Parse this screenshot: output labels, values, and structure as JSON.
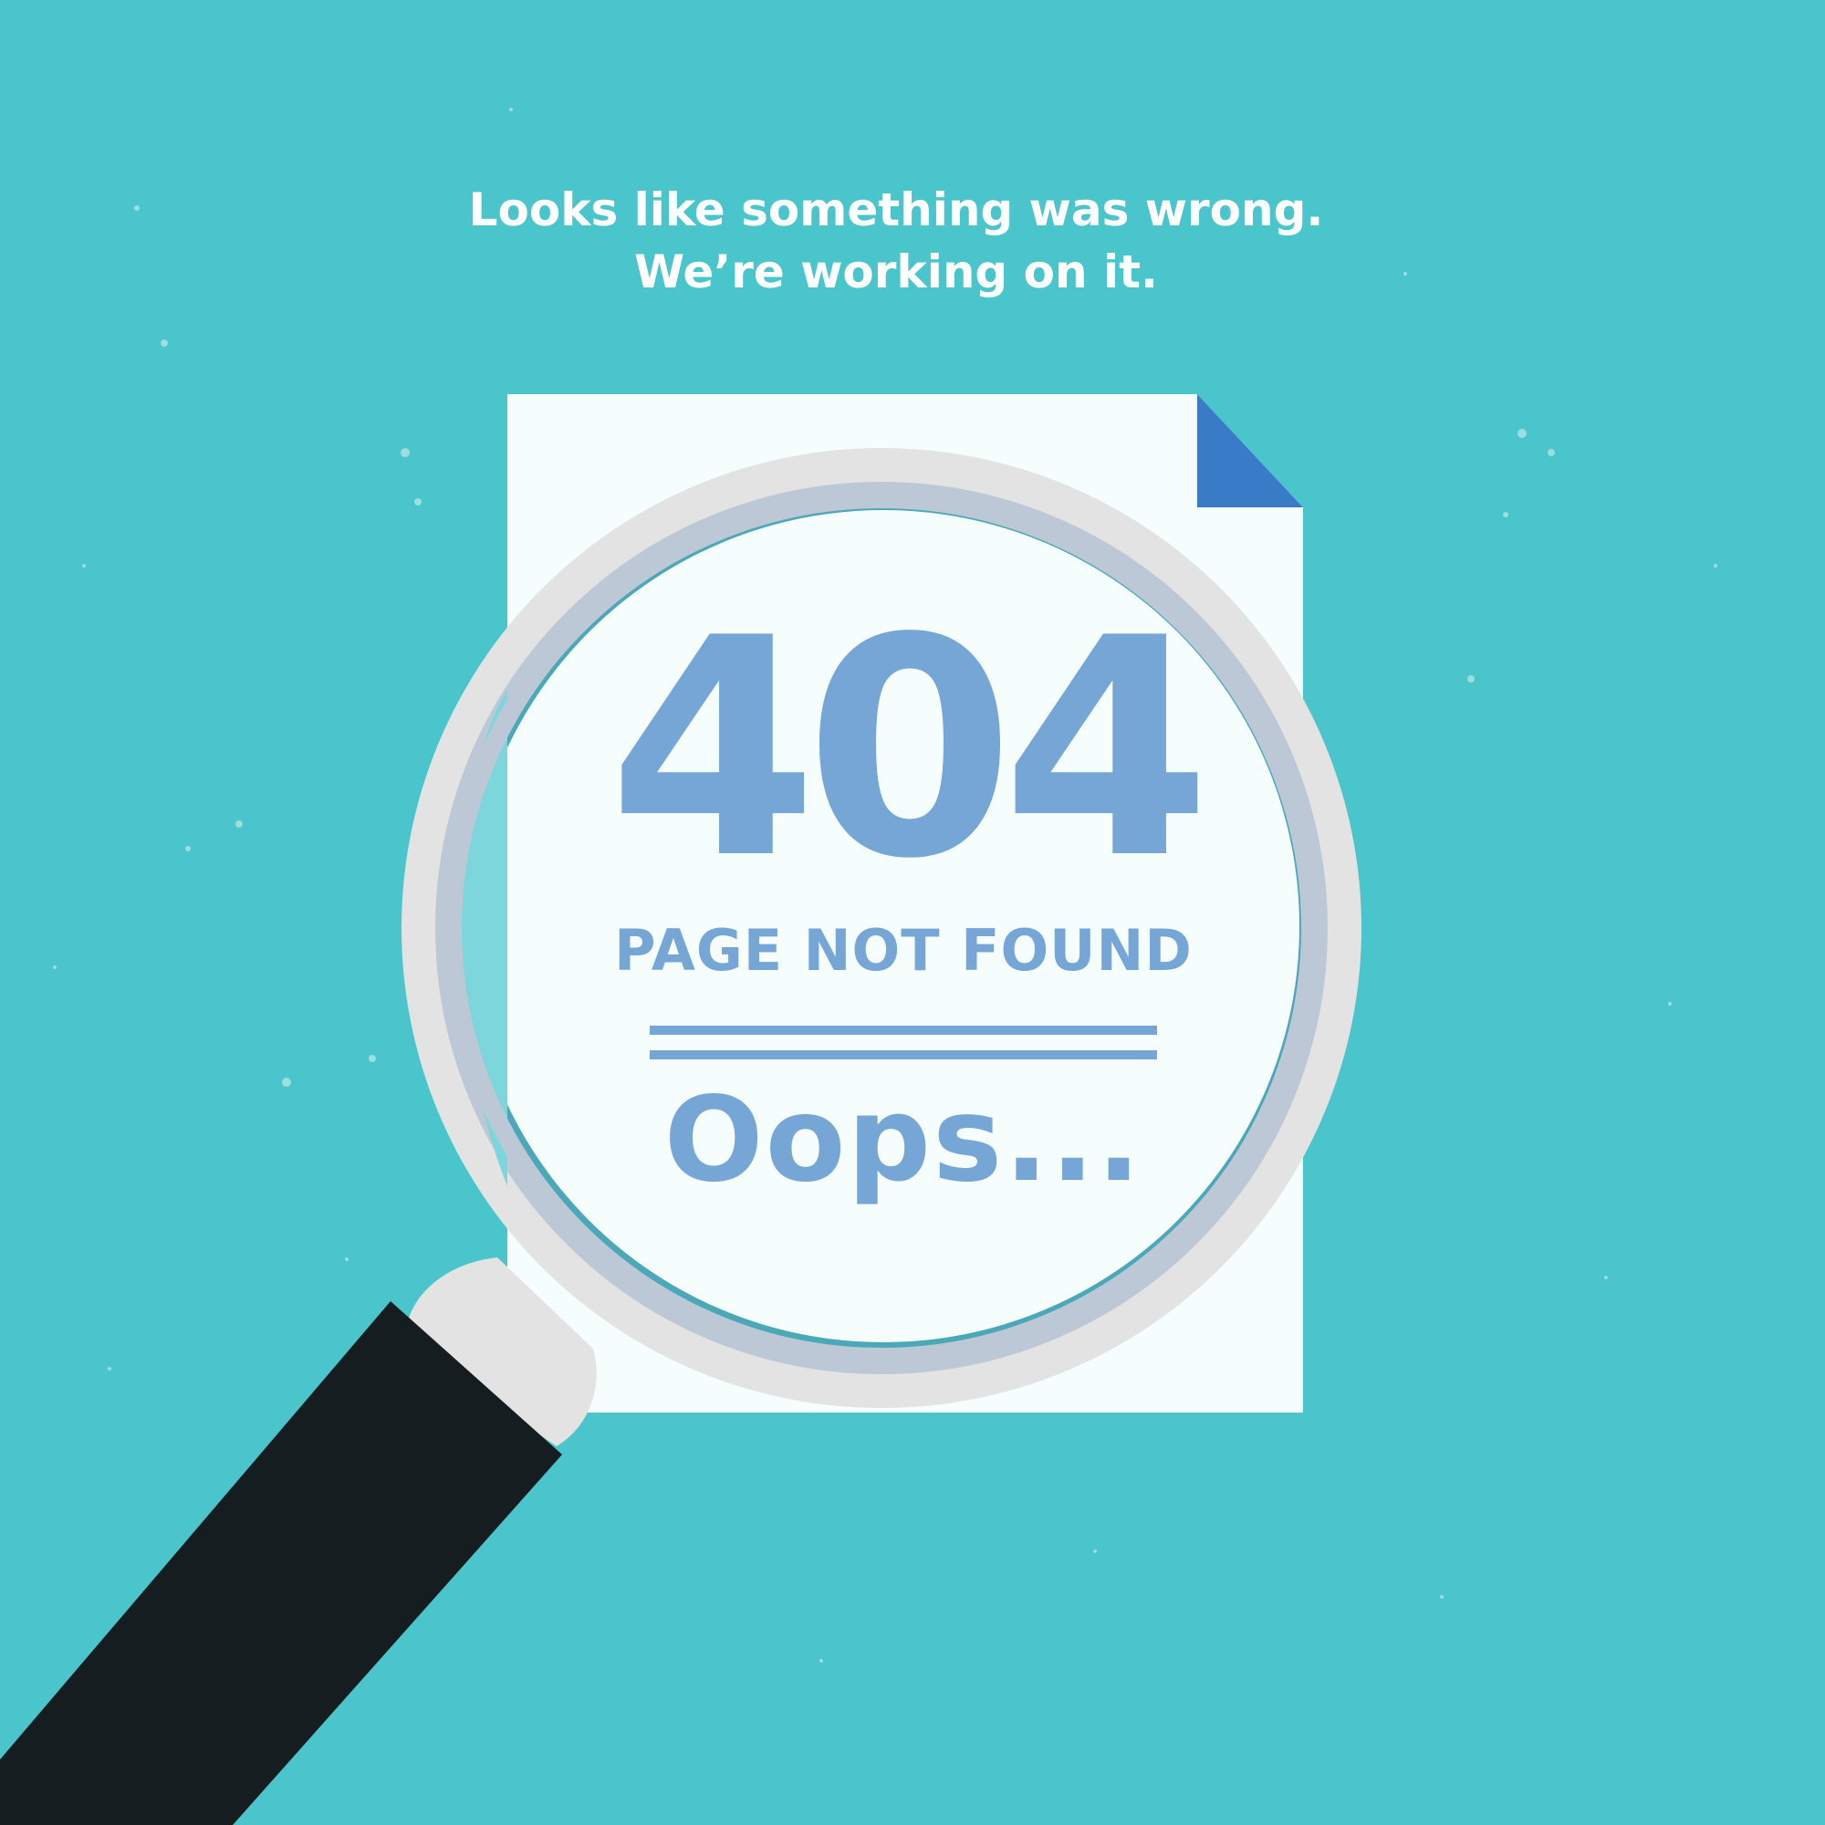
{
  "message": {
    "line1": "Looks like something was wrong.",
    "line2": "We’re working on it."
  },
  "error": {
    "code": "404",
    "title": "PAGE NOT FOUND",
    "exclamation": "Oops..."
  },
  "colors": {
    "background": "#4bc5cc",
    "accent_text": "#75a6d6",
    "document": "#f5fdfd",
    "page_fold": "#3a7bc8",
    "lens_rim": "#e3e3e3",
    "handle": "#161d20"
  },
  "icons": {
    "magnifier": "magnifying-glass-icon",
    "document": "document-icon"
  }
}
